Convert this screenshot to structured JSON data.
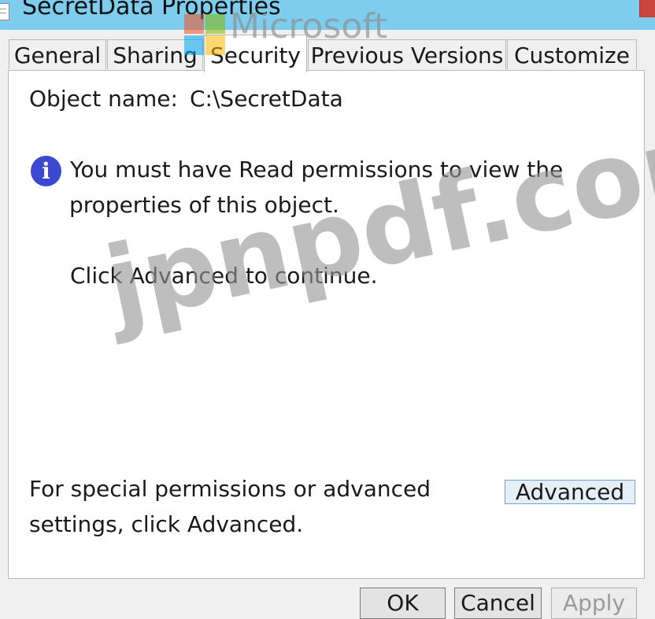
{
  "window": {
    "title": "SecretData Properties",
    "icon": "document-icon"
  },
  "tabs": [
    {
      "label": "General",
      "active": false
    },
    {
      "label": "Sharing",
      "active": false
    },
    {
      "label": "Security",
      "active": true
    },
    {
      "label": "Previous Versions",
      "active": false
    },
    {
      "label": "Customize",
      "active": false
    }
  ],
  "security": {
    "object_name_label": "Object name:",
    "object_name_value": "C:\\SecretData",
    "info_icon": "info-icon",
    "info_glyph": "i",
    "message_line1": "You must have Read permissions to view the",
    "message_line2": "properties of this object.",
    "continue_hint": "Click Advanced to continue.",
    "advanced_hint_line1": "For special permissions or advanced",
    "advanced_hint_line2": "settings, click Advanced.",
    "advanced_button": "Advanced"
  },
  "buttons": {
    "ok": "OK",
    "cancel": "Cancel",
    "apply": "Apply"
  },
  "watermarks": {
    "jpnpdf": "jpnpdf.com",
    "microsoft": "Microsoft"
  },
  "colors": {
    "titlebar": "#7fcdee",
    "info_icon": "#3b48d2",
    "advanced_button_border": "#6fa6d6"
  }
}
